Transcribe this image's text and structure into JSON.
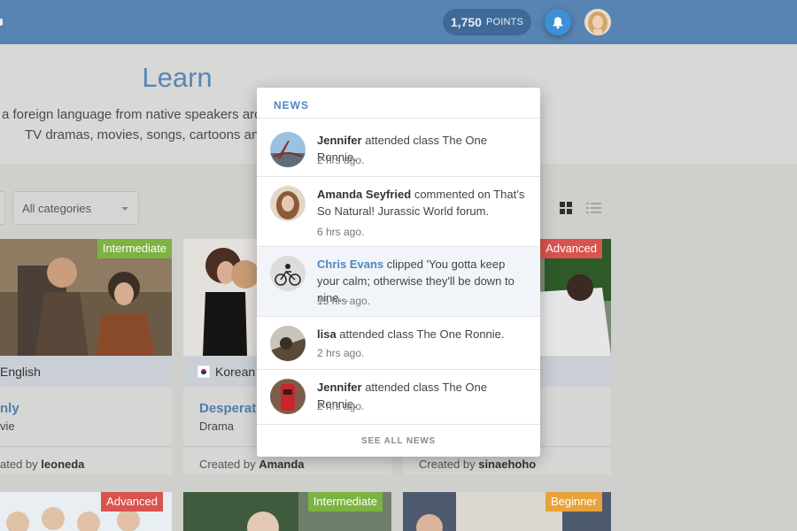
{
  "header": {
    "points_value": "1,750",
    "points_label": "POINTS",
    "bell_icon": "bell-icon",
    "accent": "#5884b3"
  },
  "hero": {
    "title": "Learn",
    "line1": "a foreign language from native speakers arc",
    "line2": "TV dramas, movies, songs, cartoons and"
  },
  "filters": {
    "category": "All categories"
  },
  "cards": [
    {
      "level": "Intermediate",
      "language": "English",
      "title": "nly",
      "genre": "vie",
      "created_prefix": "ated by",
      "creator": "leoneda"
    },
    {
      "level": "",
      "language": "Korean",
      "title": "Desperat",
      "genre": "Drama",
      "created_prefix": "Created by",
      "creator": "Amanda"
    },
    {
      "level": "Advanced",
      "language": "",
      "title": "",
      "genre": "",
      "created_prefix": "Created by",
      "creator": "sinaehoho"
    },
    {
      "level": "Advanced"
    },
    {
      "level": "Intermediate"
    },
    {
      "level": "Beginner"
    }
  ],
  "news": {
    "heading": "NEWS",
    "items": [
      {
        "who": "Jennifer",
        "text": " attended class The One Ronnie.",
        "time": "2 hrs ago."
      },
      {
        "who": "Amanda Seyfried",
        "text": " commented on That’s So Natural! Jurassic World forum.",
        "time": "6 hrs ago."
      },
      {
        "who": "Chris Evans",
        "text": " clipped 'You gotta keep your calm; otherwise they'll be down to nine...",
        "time": "15 hrs ago."
      },
      {
        "who": "lisa",
        "text": " attended class The One Ronnie.",
        "time": "2 hrs ago."
      },
      {
        "who": "Jennifer",
        "text": " attended class The One Ronnie.",
        "time": "2 hrs ago."
      }
    ],
    "footer": "SEE ALL NEWS"
  },
  "colors": {
    "intermediate": "#7cb341",
    "advanced": "#d9534f",
    "beginner": "#e8a23b",
    "link": "#4f86bf"
  }
}
